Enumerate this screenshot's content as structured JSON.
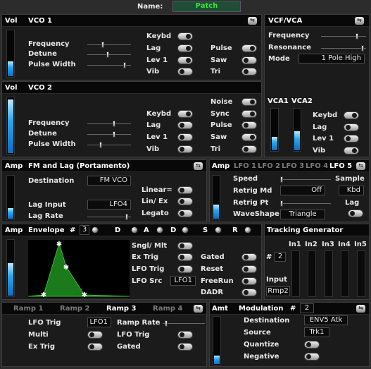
{
  "name_label": "Name:",
  "patch_name": "Patch",
  "vco1": {
    "vol": "Vol",
    "title": "VCO 1",
    "frequency": "Frequency",
    "detune": "Detune",
    "pulse_width": "Pulse Width",
    "keybd": "Keybd",
    "lag": "Lag",
    "lev1": "Lev 1",
    "vib": "Vib",
    "pulse": "Pulse",
    "saw": "Saw",
    "tri": "Tri",
    "vol_level": 0.35,
    "frequency_value": 0.35,
    "detune_value": 0.47,
    "pulse_width_value": 0.85
  },
  "vco2": {
    "vol": "Vol",
    "title": "VCO 2",
    "noise": "Noise",
    "frequency": "Frequency",
    "detune": "Detune",
    "pulse_width": "Pulse Width",
    "keybd": "Keybd",
    "sync": "Sync",
    "lag": "Lag",
    "lev1": "Lev 1",
    "vib": "Vib",
    "pulse": "Pulse",
    "saw": "Saw",
    "tri": "Tri",
    "vol_level": 0.98,
    "frequency_value": 0.62,
    "detune_value": 0.62,
    "pulse_width_value": 0.31
  },
  "vcf": {
    "title": "VCF/VCA",
    "frequency": "Frequency",
    "resonance": "Resonance",
    "mode": "Mode",
    "mode_value": "1 Pole High",
    "vca1": "VCA1",
    "vca2": "VCA2",
    "keybd": "Keybd",
    "lag": "Lag",
    "lev1": "Lev 1",
    "vib": "Vib",
    "frequency_value": 0.8,
    "resonance_value": 0.92,
    "vca1_level": 0.35,
    "vca2_level": 0.48
  },
  "fm": {
    "amp": "Amp",
    "title": "FM and Lag (Portamento)",
    "destination": "Destination",
    "destination_value": "FM VCO",
    "lag_input": "Lag Input",
    "lag_input_value": "LFO4",
    "lag_rate": "Lag Rate",
    "linear": "Linear=",
    "lin_ex": "Lin/  Ex",
    "legato": "Legato",
    "amp_level": 0.28,
    "lag_rate_value": 0.9
  },
  "lfo": {
    "amp": "Amp",
    "tabs": [
      "LFO 1",
      "LFO 2",
      "LFO 3",
      "LFO 4",
      "LFO 5"
    ],
    "speed": "Speed",
    "sample": "Sample",
    "retrig_md": "Retrig Md",
    "retrig_md_value": "Off",
    "kbd": "Kbd",
    "retrig_pt": "Retrig Pt",
    "lag": "Lag",
    "waveshape": "WaveShape",
    "waveshape_value": "Triangle",
    "amp_level": 0.35,
    "speed_value": 0.03,
    "retrig_pt_value": 0.03
  },
  "env": {
    "amp": "Amp",
    "title": "Envelope",
    "hash": "#",
    "number": "3",
    "stages": [
      "D",
      "A",
      "D",
      "S",
      "R"
    ],
    "sngl_mlt": "Sngl/  Mlt",
    "ex_trig": "Ex Trig",
    "lfo_trig": "LFO Trig",
    "lfo_src": "LFO Src",
    "lfo_src_value": "LFO1",
    "gated": "Gated",
    "reset": "Reset",
    "freerun": "FreeRun",
    "dadr": "DADR",
    "amp_level": 0.6
  },
  "tracking": {
    "title": "Tracking Generator",
    "hash": "#",
    "number": "2",
    "inputs": [
      "In1",
      "In2",
      "In3",
      "In4",
      "In5"
    ],
    "input_label": "Input",
    "input_value": "Rmp2"
  },
  "ramp": {
    "tabs": [
      "Ramp 1",
      "Ramp 2",
      "Ramp 3",
      "Ramp 4"
    ],
    "lfo_trig": "LFO Trig",
    "lfo_trig_value": "LFO1",
    "multi": "Multi",
    "ex_trig": "Ex Trig",
    "ramp_rate": "Ramp Rate",
    "lfo_trig2": "LFO Trig",
    "gated": "Gated",
    "ramp_rate_value": 0.08
  },
  "mod": {
    "amt": "Amt",
    "title": "Modulation",
    "hash": "#",
    "number": "2",
    "destination": "Destination",
    "destination_value": "ENV5 Atk",
    "source": "Source",
    "source_value": "Trk1",
    "quantize": "Quantize",
    "negative": "Negative",
    "amt_level": 0.2
  },
  "icons": {
    "menu": "menu-arrows-icon",
    "knob": "knob-icon"
  },
  "colors": {
    "patch_text": "#39e23a",
    "meter": "#29a8ec",
    "envelope_fill": "#1b7a1b"
  }
}
